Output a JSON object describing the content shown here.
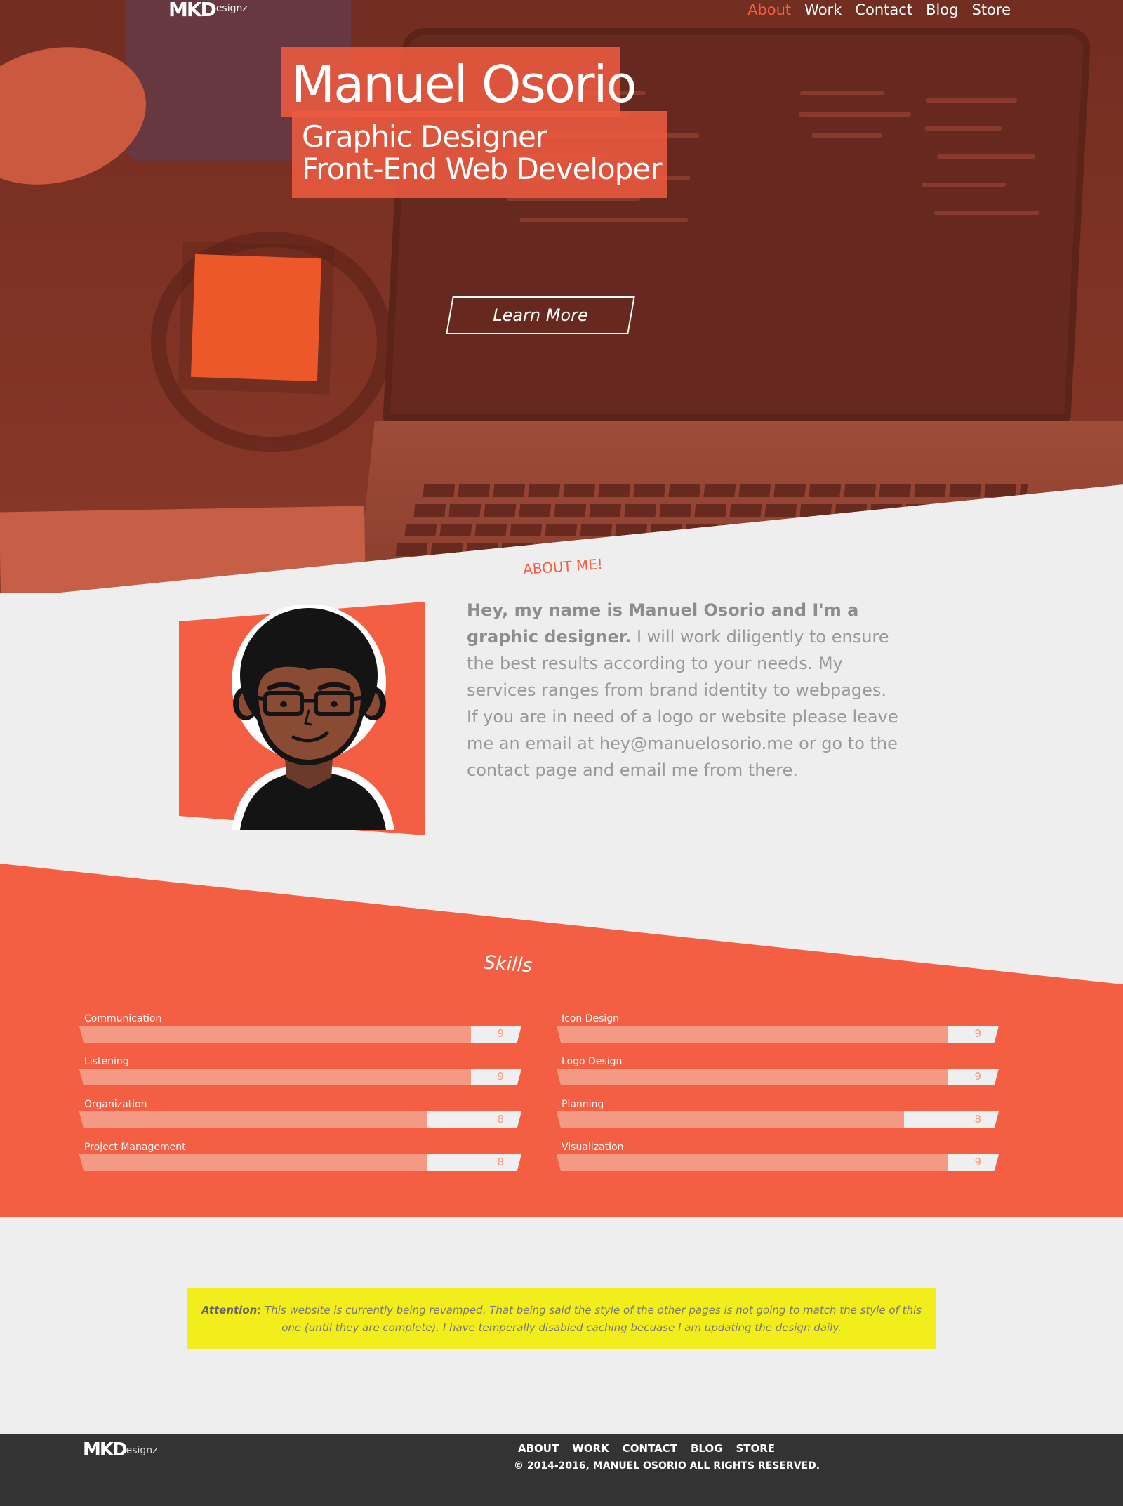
{
  "header": {
    "logo": {
      "mk": "MKD",
      "esignz": "esignz"
    },
    "nav": [
      {
        "label": "About",
        "active": true
      },
      {
        "label": "Work",
        "active": false
      },
      {
        "label": "Contact",
        "active": false
      },
      {
        "label": "Blog",
        "active": false
      },
      {
        "label": "Store",
        "active": false
      }
    ]
  },
  "hero": {
    "name": "Manuel Osorio",
    "role_line_1": "Graphic Designer",
    "role_line_2": "Front-End Web Developer",
    "cta_label": "Learn More"
  },
  "about": {
    "title": "ABOUT ME!",
    "intro_bold": "Hey, my name is Manuel Osorio and I'm a graphic designer.",
    "body": " I will work diligently to ensure the best results according to your needs. My services ranges from brand identity to webpages. If you are in need of a logo or website please leave me an email at hey@manuelosorio.me or go to the contact page and email me from there."
  },
  "skills": {
    "title": "Skills",
    "max": 10,
    "items": [
      {
        "name": "Communication",
        "value": 9
      },
      {
        "name": "Icon Design",
        "value": 9
      },
      {
        "name": "Listening",
        "value": 9
      },
      {
        "name": "Logo Design",
        "value": 9
      },
      {
        "name": "Organization",
        "value": 8
      },
      {
        "name": "Planning",
        "value": 8
      },
      {
        "name": "Project Management",
        "value": 8
      },
      {
        "name": "Visualization",
        "value": 9
      }
    ]
  },
  "notice": {
    "label": "Attention:",
    "text": " This website is currently being revamped. That being said the style of the other pages is not going to match the style of this one (until they are complete). I have temperally disabled caching becuase I am updating the design daily."
  },
  "footer": {
    "logo": {
      "mk": "MKD",
      "esignz": "esignz"
    },
    "nav": [
      "ABOUT",
      "WORK",
      "CONTACT",
      "BLOG",
      "STORE"
    ],
    "copyright": "© 2014-2016, MANUEL OSORIO ALL RIGHTS RESERVED."
  },
  "colors": {
    "accent": "#f45e42",
    "skill_fill": "#f49a84",
    "notice_bg": "#f1ee1c",
    "footer_bg": "#333333",
    "page_bg": "#eeeeee"
  },
  "icons": {
    "avatar": "cartoon-avatar-with-glasses"
  }
}
